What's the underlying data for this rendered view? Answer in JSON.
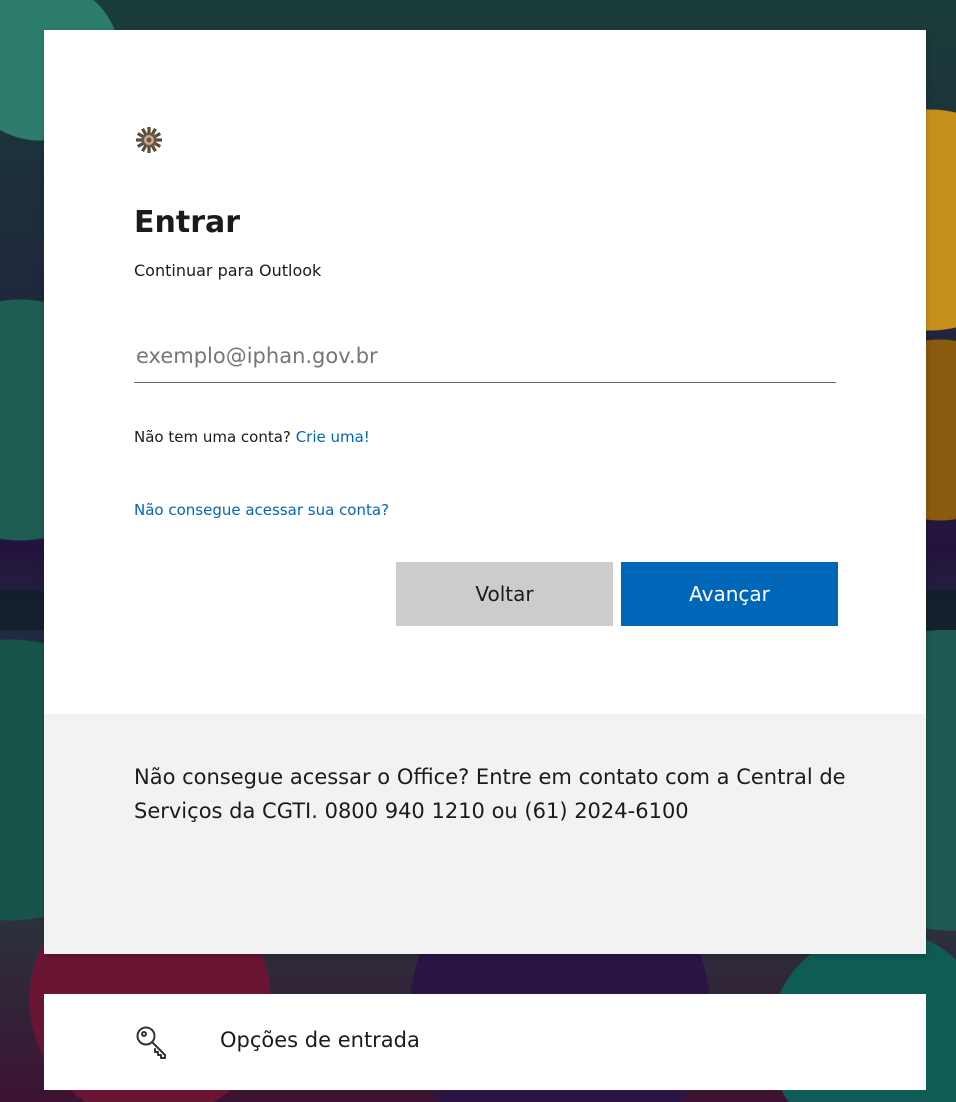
{
  "signin": {
    "logo_icon": "org-emblem-icon",
    "title": "Entrar",
    "subtitle": "Continuar para Outlook",
    "email_placeholder": "exemplo@iphan.gov.br",
    "email_value": "",
    "no_account_text": "Não tem uma conta?",
    "create_link": "Crie uma!",
    "cant_access_link": "Não consegue acessar sua conta?",
    "back_button": "Voltar",
    "next_button": "Avançar",
    "accent_color": "#0067b8"
  },
  "footer": {
    "help_text": "Não consegue acessar o Office? Entre em contato com a Central de Serviços da CGTI. 0800 940 1210 ou (61) 2024-6100"
  },
  "signin_options": {
    "icon": "key-icon",
    "label": "Opções de entrada"
  }
}
